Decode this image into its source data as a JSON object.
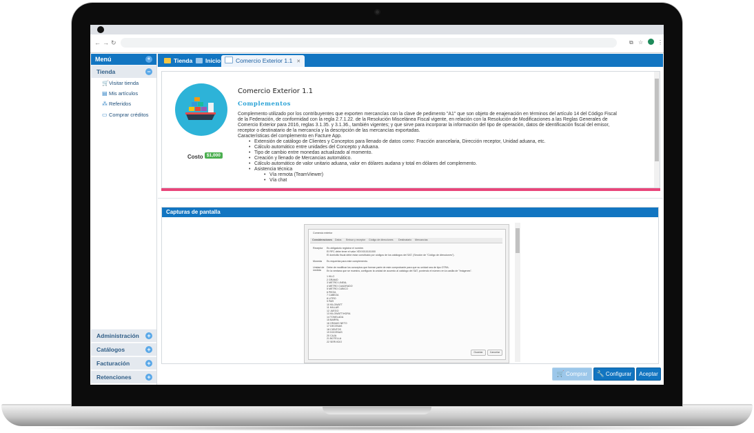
{
  "sidebar": {
    "header": "Menú",
    "active_section": "Tienda",
    "items": [
      {
        "label": "Visitar tienda",
        "icon": "cart-icon"
      },
      {
        "label": "Mis artículos",
        "icon": "document-icon"
      },
      {
        "label": "Referidos",
        "icon": "network-icon"
      },
      {
        "label": "Comprar créditos",
        "icon": "credit-card-icon"
      }
    ],
    "sections": [
      "Administración",
      "Catálogos",
      "Facturación",
      "Retenciones"
    ]
  },
  "tabs": [
    {
      "label": "Tienda",
      "icon": "store-icon"
    },
    {
      "label": "Inicio",
      "icon": "home-icon"
    },
    {
      "label": "Comercio Exterior 1.1",
      "icon": "window-icon",
      "close": "✕"
    }
  ],
  "product": {
    "title": "Comercio Exterior 1.1",
    "subtitle": "Complementos",
    "cost_label": "Costo",
    "cost_value": "$1,000",
    "description_lines": [
      "Complemento utilizado por los contribuyentes que exporten mercancías con la clave de pedimento \"A1\" que son objeto de enajenación en términos del artículo 14 del Código Fiscal",
      "de la Federación, de conformidad con la regla 2.7.1.22. de la Resolución Miscelánea Fiscal vigente, en relación con la Resolución de Modificaciones a las Reglas Generales de",
      "Comercio Exterior para 2016, reglas 3.1.35. y 3.1.36., también vigentes; y que sirve para incorporar la información del tipo de operación, datos de identificación fiscal del emisor,",
      "receptor o destinatario de la mercancía y la descripción de las mercancías exportadas.",
      "Características del complemento en Facture App."
    ],
    "features": [
      "Extensión de catálogo de Clientes y Conceptos para llenado de datos como: Fracción arancelaria, Dirección receptor, Unidad aduana, etc.",
      "Cálculo automático entre unidades del Concepto y Aduana.",
      "Tipo de cambio entre monedas actualizado al momento.",
      "Creación y llenado de Mercancias automático.",
      "Cálculo automático de valor unitario aduana, valor en dólares audana y total en dólares del complemento.",
      "Asistencia técnica"
    ],
    "sub_features": [
      "Vía remota (TeamViewer)",
      "Vía chat"
    ]
  },
  "screenshots": {
    "header": "Capturas de pantalla",
    "preview": {
      "window_title": "Comercio exterior",
      "tabs": [
        "Consideraciones",
        "Datos",
        "Emisor y receptor",
        "Código de direcciones",
        "Destinatario",
        "Mercancías"
      ],
      "rows": [
        {
          "label": "Receptor",
          "text": "Es obligatorio registrar el nombre."
        },
        {
          "label": "",
          "text": "El RFC debe tener el valor XEXX010101000"
        },
        {
          "label": "",
          "text": "El domicilio fiscal debe estar constituido por códigos de los catálogos del SAT. (Sección de \"Código de direcciones\")."
        },
        {
          "label": "Moneda",
          "text": "Es requerida para este complemento."
        },
        {
          "label": "Unidad de medida",
          "text": "Debe de modificar los conceptos que forman parte de este comprobante para que su unidad sea de tipo OTRA."
        },
        {
          "label": "",
          "text": "En la ventana que se muestra, configurar la unidad de acuerdo al catálogo del SAT, poniendo el número en la casilla de \"Imágenes\"."
        }
      ],
      "list": [
        "1 KILO",
        "2 GRAMO",
        "3 METRO LINEAL",
        "4 METRO CUADRADO",
        "5 METRO CUBICO",
        "6 PIEZA",
        "7 CABEZA",
        "8 LITRO",
        "9 PAR",
        "10 KILOWATT",
        "11 MILLAR",
        "12 JUEGO",
        "13 KILOWATT/HORA",
        "14 TONELADA",
        "15 BARRIL",
        "16 GRAMO NETO",
        "17 DECENAS",
        "18 CIENTOS",
        "19 DOCENAS",
        "20 CAJA",
        "21 BOTELLA",
        "22 SERVICIO"
      ],
      "buttons": [
        "Guardar",
        "Cancelar"
      ]
    }
  },
  "buttons": {
    "comprar": "Comprar",
    "configurar": "Configurar",
    "aceptar": "Aceptar"
  },
  "colors": {
    "primary": "#1275c1",
    "accent_pink": "#e9457a",
    "badge_green": "#4caf50",
    "subtitle_blue": "#29a2d6"
  }
}
